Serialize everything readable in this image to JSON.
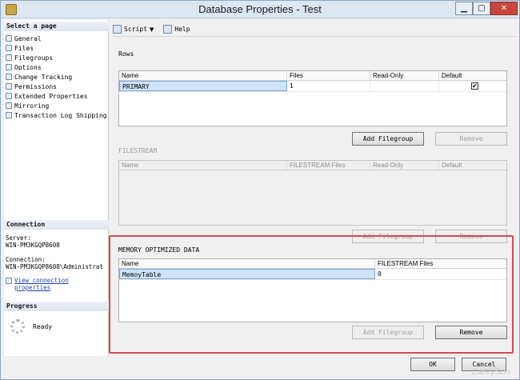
{
  "window": {
    "title": "Database Properties - Test",
    "controls": {
      "minimize": "▁",
      "maximize": "▢",
      "close": "✕"
    }
  },
  "left_panel": {
    "select_page_heading": "Select a page",
    "pages": [
      {
        "label": "General",
        "icon": "page-icon"
      },
      {
        "label": "Files",
        "icon": "page-icon"
      },
      {
        "label": "Filegroups",
        "icon": "page-icon"
      },
      {
        "label": "Options",
        "icon": "page-icon"
      },
      {
        "label": "Change Tracking",
        "icon": "page-icon"
      },
      {
        "label": "Permissions",
        "icon": "page-icon"
      },
      {
        "label": "Extended Properties",
        "icon": "page-icon"
      },
      {
        "label": "Mirroring",
        "icon": "page-icon"
      },
      {
        "label": "Transaction Log Shipping",
        "icon": "page-icon"
      }
    ],
    "connection_heading": "Connection",
    "server_label": "Server:",
    "server_value": "WIN-PM3KGQP8608",
    "connection_label": "Connection:",
    "connection_value": "WIN-PM3KGQP8608\\Administrat",
    "view_link_line1": "View connection",
    "view_link_line2": "properties",
    "progress_heading": "Progress",
    "progress_status": "Ready"
  },
  "toolbar": {
    "script_label": "Script",
    "script_arrow": "▼",
    "help_label": "Help"
  },
  "rows_section": {
    "label": "Rows",
    "columns": [
      "Name",
      "Files",
      "Read-Only",
      "Default"
    ],
    "rows": [
      {
        "name": "PRIMARY",
        "files": "1",
        "read_only": "",
        "default_checked": "✔"
      }
    ],
    "add_button": "Add Filegroup",
    "remove_button": "Remove"
  },
  "filestream_section": {
    "label": "FILESTREAM",
    "columns": [
      "Name",
      "FILESTREAM Files",
      "Read-Only",
      "Default"
    ],
    "add_button": "Add Filegroup",
    "remove_button": "Remove"
  },
  "memory_section": {
    "label": "MEMORY OPTIMIZED DATA",
    "columns": [
      "Name",
      "FILESTREAM Files"
    ],
    "rows": [
      {
        "name": "MemoyTable",
        "files": "0"
      }
    ],
    "add_button": "Add Filegroup",
    "remove_button": "Remove"
  },
  "footer": {
    "ok_button": "OK",
    "cancel_button": "Cancel"
  },
  "watermark": "CareySon",
  "colors": {
    "highlight_border": "#d64a4a",
    "selection": "#cde3f7",
    "link": "#1a44b0"
  }
}
